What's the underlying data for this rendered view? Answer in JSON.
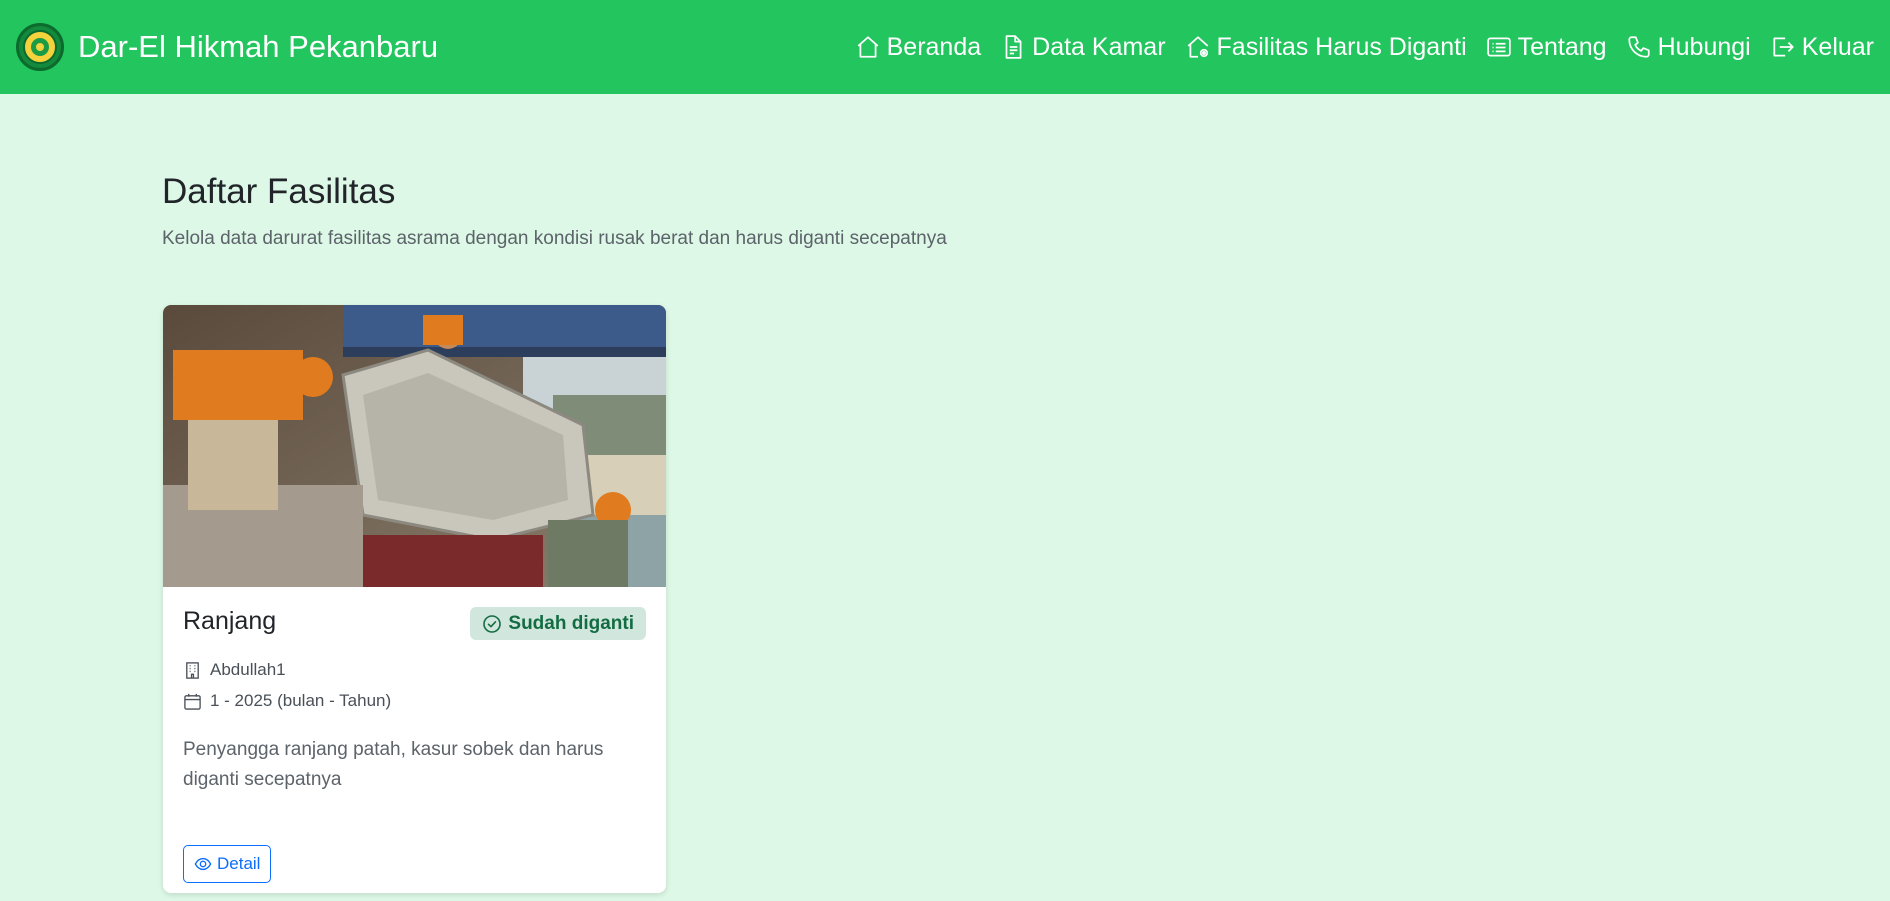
{
  "brand": {
    "name": "Dar-El Hikmah Pekanbaru",
    "logo_icon": "school-emblem-icon"
  },
  "nav": {
    "items": [
      {
        "label": "Beranda",
        "icon": "house-icon"
      },
      {
        "label": "Data Kamar",
        "icon": "document-icon"
      },
      {
        "label": "Fasilitas Harus Diganti",
        "icon": "house-gear-icon"
      },
      {
        "label": "Tentang",
        "icon": "list-card-icon"
      },
      {
        "label": "Hubungi",
        "icon": "phone-icon"
      },
      {
        "label": "Keluar",
        "icon": "logout-icon"
      }
    ]
  },
  "page": {
    "title": "Daftar Fasilitas",
    "subtitle": "Kelola data darurat fasilitas asrama dengan kondisi rusak berat dan harus diganti secepatnya"
  },
  "cards": [
    {
      "title": "Ranjang",
      "status": "Sudah diganti",
      "room": "Abdullah1",
      "period": "1 - 2025 (bulan - Tahun)",
      "description": "Penyangga ranjang patah, kasur sobek dan harus diganti secepatnya",
      "button_label": "Detail"
    }
  ],
  "colors": {
    "navbar": "#22c55e",
    "background": "#ddf8e6",
    "badge_bg": "#d1e7dd",
    "badge_text": "#146c43",
    "primary": "#0d6efd"
  }
}
